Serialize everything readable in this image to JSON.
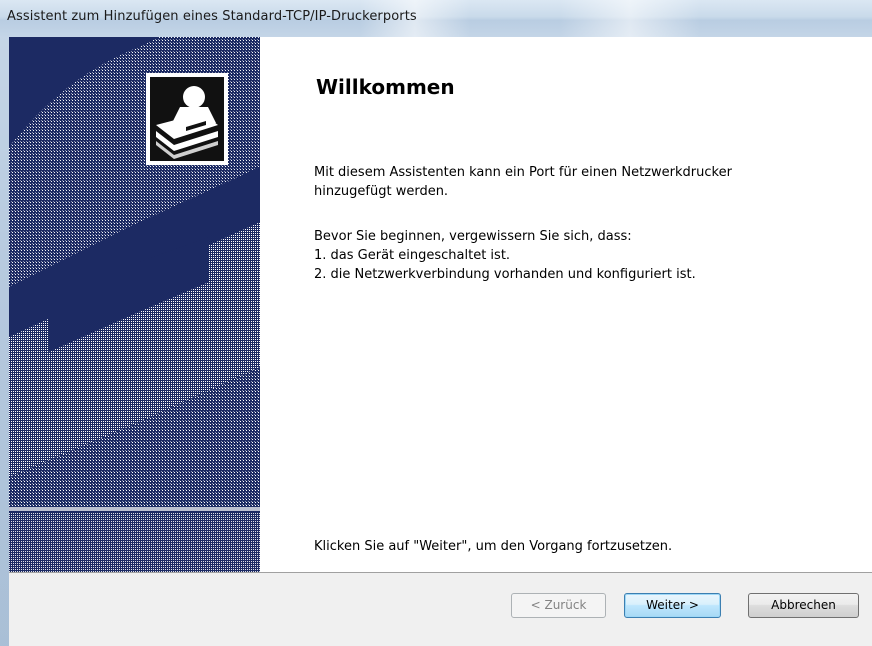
{
  "window": {
    "title": "Assistent zum Hinzufügen eines Standard-TCP/IP-Druckerports"
  },
  "banner": {
    "icon": "printer-port-wizard-icon",
    "colors": {
      "background": "#1c2a63",
      "art": "#ffffff"
    }
  },
  "content": {
    "heading": "Willkommen",
    "intro_line1": "Mit diesem Assistenten kann ein Port für einen Netzwerkdrucker",
    "intro_line2": "hinzugefügt werden.",
    "before_text": "Bevor Sie beginnen, vergewissern Sie sich, dass:",
    "checklist": [
      "1.  das Gerät eingeschaltet ist.",
      "2.  die Netzwerkverbindung vorhanden und konfiguriert ist."
    ],
    "continue_text": "Klicken Sie auf \"Weiter\", um den Vorgang fortzusetzen."
  },
  "buttons": {
    "back": "< Zurück",
    "next": "Weiter >",
    "cancel": "Abbrechen"
  }
}
